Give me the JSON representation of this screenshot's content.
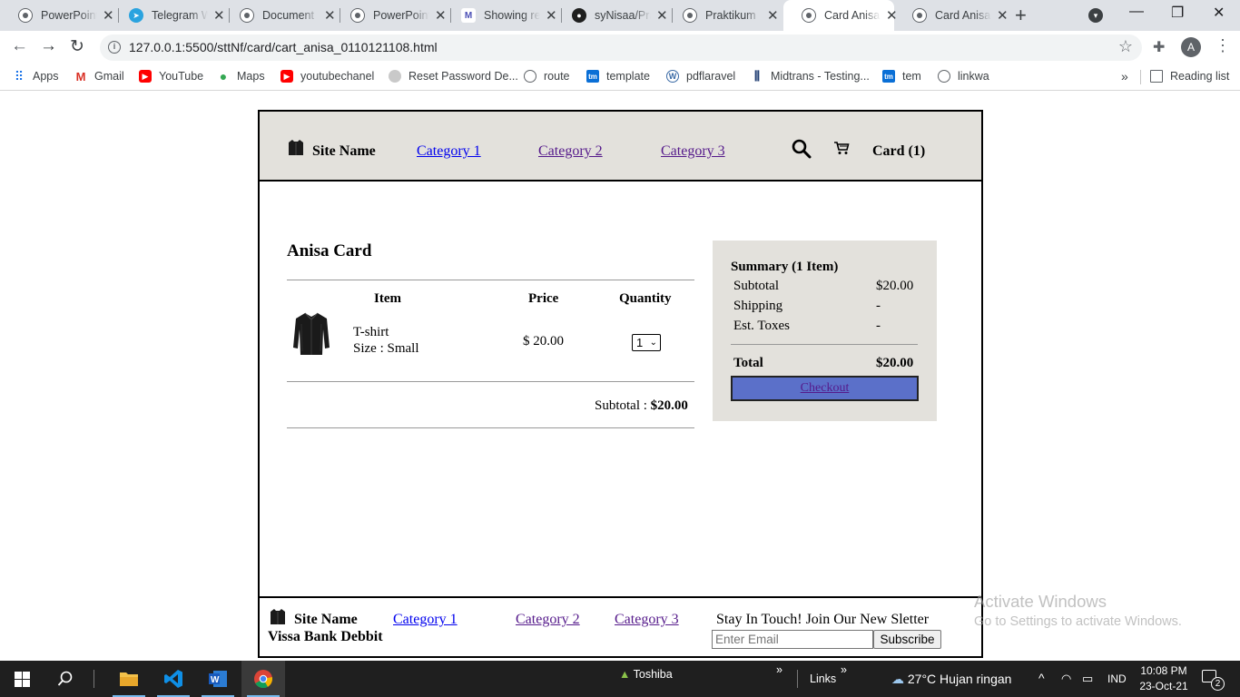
{
  "browser": {
    "tabs": [
      {
        "title": "PowerPoint",
        "icon": "globe"
      },
      {
        "title": "Telegram Web",
        "icon": "telegram"
      },
      {
        "title": "Document",
        "icon": "globe"
      },
      {
        "title": "PowerPoint",
        "icon": "globe"
      },
      {
        "title": "Showing results",
        "icon": "mh"
      },
      {
        "title": "syNisaa/Praktikum",
        "icon": "github"
      },
      {
        "title": "Praktikum",
        "icon": "globe"
      },
      {
        "title": "Card Anisa",
        "icon": "globe"
      },
      {
        "title": "Card Anisa",
        "icon": "globe"
      }
    ],
    "active_tab_index": 7,
    "url": "127.0.0.1:5500/sttNf/card/cart_anisa_0110121108.html",
    "profile_initial": "A",
    "bookmarks": [
      {
        "label": "Apps",
        "icon": "grid"
      },
      {
        "label": "Gmail",
        "icon": "gmail"
      },
      {
        "label": "YouTube",
        "icon": "youtube"
      },
      {
        "label": "Maps",
        "icon": "maps"
      },
      {
        "label": "youtubechanel",
        "icon": "youtube"
      },
      {
        "label": "Reset Password De...",
        "icon": "user"
      },
      {
        "label": "route",
        "icon": "globe"
      },
      {
        "label": "template",
        "icon": "tm"
      },
      {
        "label": "pdflaravel",
        "icon": "wordpress"
      },
      {
        "label": "Midtrans - Testing...",
        "icon": "midtrans"
      },
      {
        "label": "tem",
        "icon": "tm"
      },
      {
        "label": "linkwa",
        "icon": "globe"
      }
    ],
    "reading_list": "Reading list"
  },
  "site": {
    "header": {
      "brand": "Site Name",
      "nav": [
        "Category 1",
        "Category 2",
        "Category 3"
      ],
      "cart_label": "Card (1)"
    },
    "cart": {
      "title": "Anisa Card",
      "columns": {
        "item": "Item",
        "price": "Price",
        "quantity": "Quantity"
      },
      "item": {
        "name": "T-shirt",
        "size": "Size : Small",
        "price": "$ 20.00",
        "quantity": "1"
      },
      "subtotal_label": "Subtotal :",
      "subtotal_value": "$20.00"
    },
    "summary": {
      "title": "Summary (1 Item)",
      "rows": [
        {
          "label": "Subtotal",
          "value": "$20.00"
        },
        {
          "label": "Shipping",
          "value": "-"
        },
        {
          "label": "Est. Toxes",
          "value": "-"
        }
      ],
      "total_label": "Total",
      "total_value": "$20.00",
      "checkout_label": "Checkout"
    },
    "footer": {
      "brand": "Site Name",
      "bank": "Vissa Bank Debbit",
      "nav": [
        "Category 1",
        "Category 2",
        "Category 3"
      ],
      "newsletter": "Stay In Touch! Join Our New Sletter",
      "email_placeholder": "Enter Email",
      "subscribe_label": "Subscribe"
    }
  },
  "watermark": {
    "line1": "Activate Windows",
    "line2": "Go to Settings to activate Windows."
  },
  "taskbar": {
    "toshiba": "Toshiba",
    "links": "Links",
    "weather": "27°C  Hujan ringan",
    "language": "IND",
    "time": "10:08 PM",
    "date": "23-Oct-21",
    "notifications": "2"
  },
  "colors": {
    "header_bg": "#e3e1dc",
    "summary_bg": "#e3e1dc",
    "checkout_bg": "#5b70c9",
    "link": "#0000ee",
    "visited_link": "#551a8b"
  }
}
